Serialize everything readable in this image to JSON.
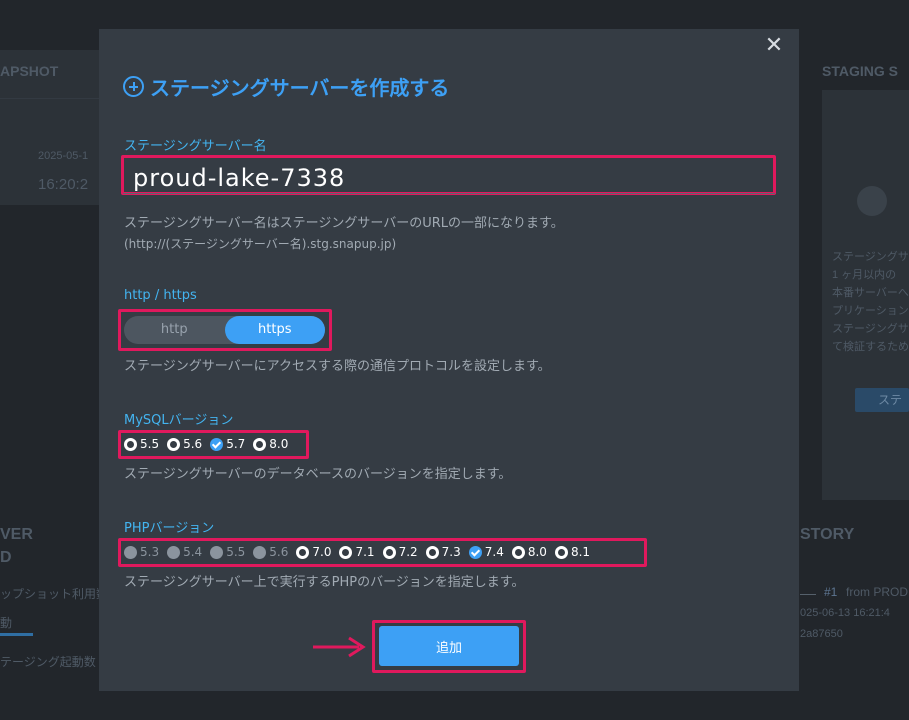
{
  "background": {
    "left_labels": [
      "APSHOT",
      "2025-05-1",
      "16:20:2",
      "VER",
      "D",
      "ップショット利用数",
      "動",
      "テージング起動数"
    ],
    "right_labels": [
      "STAGING S",
      "ステージングサ",
      "1 ヶ月以内の",
      "本番サーバーへ",
      "プリケーション",
      "ステージングサ",
      "て検証するため",
      "ステ",
      "STORY",
      "#1",
      "from PROD",
      "025-06-13 16:21:4",
      "2a87650"
    ]
  },
  "modal": {
    "close_glyph": "✕",
    "title": "ステージングサーバーを作成する",
    "name_section": {
      "label": "ステージングサーバー名",
      "value": "proud-lake-7338",
      "help_line1": "ステージングサーバー名はステージングサーバーのURLの一部になります。",
      "help_line2": "(http://(ステージングサーバー名).stg.snapup.jp)"
    },
    "protocol_section": {
      "label": "http / https",
      "options": [
        "http",
        "https"
      ],
      "selected": "https",
      "help": "ステージングサーバーにアクセスする際の通信プロトコルを設定します。"
    },
    "mysql_section": {
      "label": "MySQLバージョン",
      "options": [
        "5.5",
        "5.6",
        "5.7",
        "8.0"
      ],
      "selected": "5.7",
      "help": "ステージングサーバーのデータベースのバージョンを指定します。"
    },
    "php_section": {
      "label": "PHPバージョン",
      "options": [
        "5.3",
        "5.4",
        "5.5",
        "5.6",
        "7.0",
        "7.1",
        "7.2",
        "7.3",
        "7.4",
        "8.0",
        "8.1"
      ],
      "disabled": [
        "5.3",
        "5.4",
        "5.5",
        "5.6"
      ],
      "selected": "7.4",
      "help": "ステージングサーバー上で実行するPHPのバージョンを指定します。"
    },
    "submit_label": "追加"
  },
  "colors": {
    "accent": "#3da0f5",
    "highlight": "#e0195d",
    "label": "#43b4f0"
  }
}
